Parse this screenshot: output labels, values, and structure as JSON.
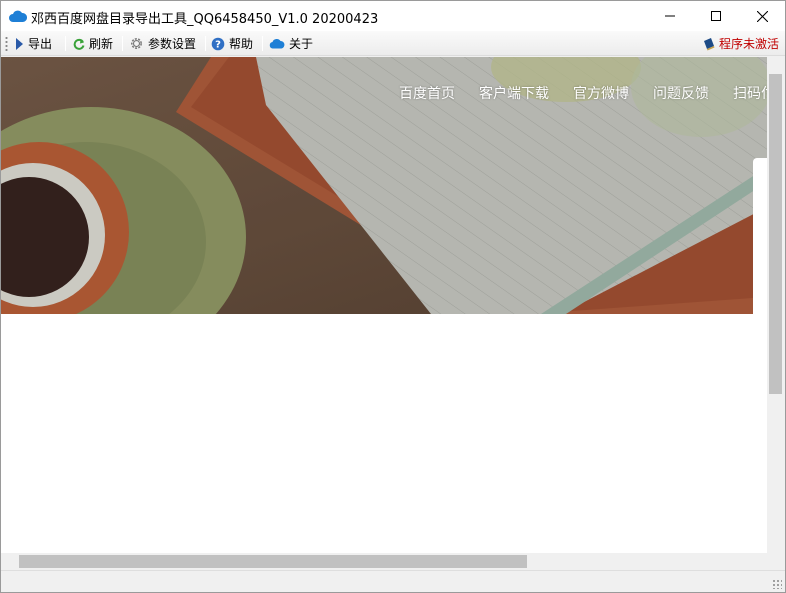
{
  "window": {
    "title": "邓西百度网盘目录导出工具_QQ6458450_V1.0 20200423"
  },
  "toolbar": {
    "items": [
      {
        "label": "导出",
        "icon": "play-arrow-icon"
      },
      {
        "label": "刷新",
        "icon": "refresh-icon"
      },
      {
        "label": "参数设置",
        "icon": "gear-icon"
      },
      {
        "label": "帮助",
        "icon": "help-icon"
      },
      {
        "label": "关于",
        "icon": "cloud-icon"
      }
    ],
    "activation_status": "程序未激活"
  },
  "hero": {
    "nav": [
      "百度首页",
      "客户端下载",
      "官方微博",
      "问题反馈",
      "扫码付"
    ]
  },
  "colors": {
    "accent_blue": "#1e7fd6",
    "refresh_green": "#3aa23a",
    "activation_red": "#c00000"
  }
}
